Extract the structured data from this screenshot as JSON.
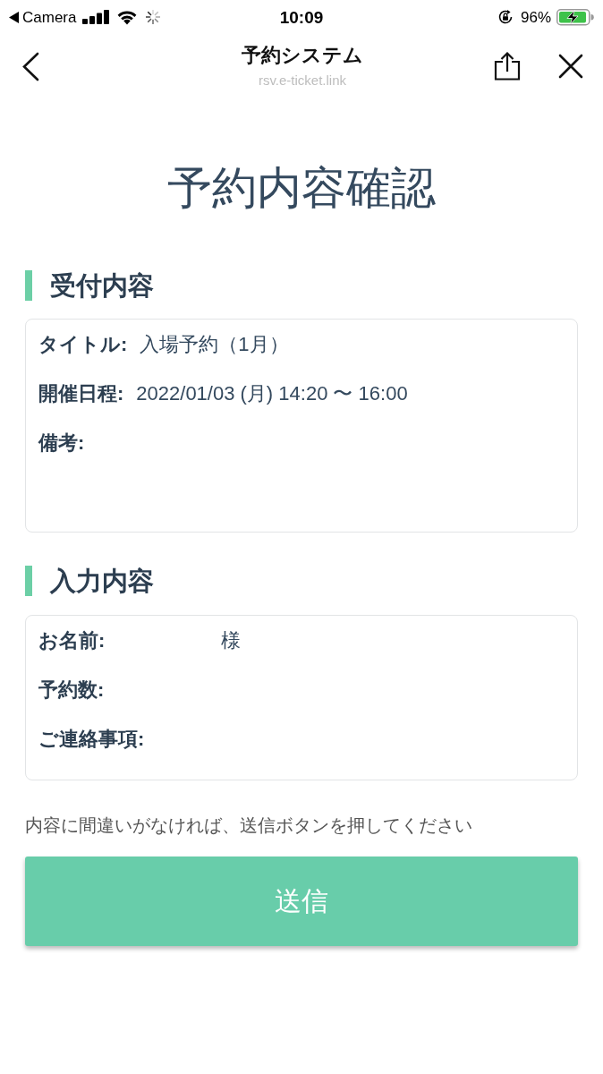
{
  "status_bar": {
    "back_app": "Camera",
    "time": "10:09",
    "battery_percent": "96%",
    "charging": true
  },
  "header": {
    "title": "予約システム",
    "url": "rsv.e-ticket.link"
  },
  "page_title": "予約内容確認",
  "sections": [
    {
      "heading": "受付内容",
      "rows": [
        {
          "kind": "line",
          "label": "タイトル:",
          "value": "入場予約（1月）"
        },
        {
          "kind": "line",
          "label": "開催日程:",
          "value": "2022/01/03 (月) 14:20 〜 16:00"
        },
        {
          "kind": "multiline",
          "label": "備考:"
        }
      ]
    },
    {
      "heading": "入力内容",
      "rows": [
        {
          "kind": "line",
          "label": "お名前:",
          "value": "様"
        },
        {
          "kind": "line",
          "label": "予約数:"
        },
        {
          "kind": "line",
          "label": "ご連絡事項:"
        }
      ]
    }
  ],
  "instruction": "内容に間違いがなければ、送信ボタンを押してください",
  "submit_button": {
    "label": "送信"
  }
}
